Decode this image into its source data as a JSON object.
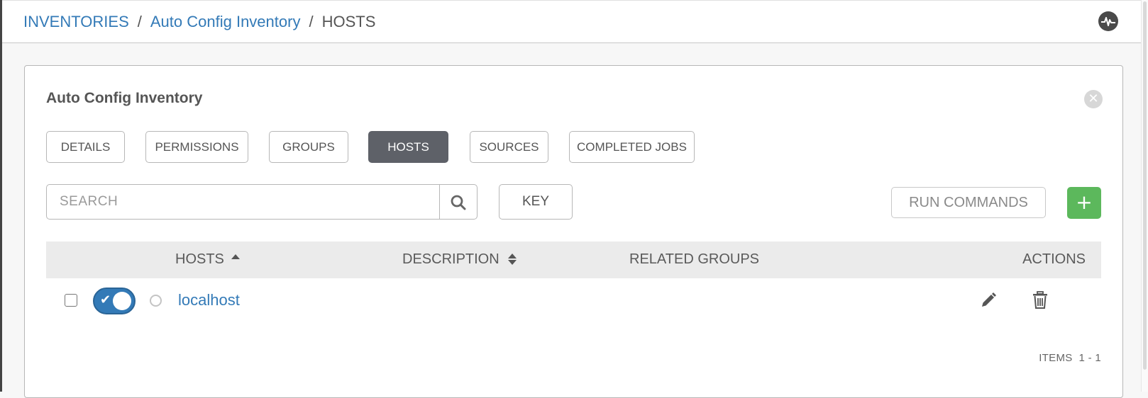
{
  "breadcrumb": {
    "items": [
      "INVENTORIES",
      "Auto Config Inventory",
      "HOSTS"
    ],
    "separator": "/"
  },
  "header": {
    "activity_icon": "activity-stream-icon"
  },
  "panel": {
    "title": "Auto Config Inventory",
    "close_icon": "close-icon",
    "close_glyph": "✕"
  },
  "tabs": [
    {
      "label": "DETAILS",
      "active": false
    },
    {
      "label": "PERMISSIONS",
      "active": false
    },
    {
      "label": "GROUPS",
      "active": false
    },
    {
      "label": "HOSTS",
      "active": true
    },
    {
      "label": "SOURCES",
      "active": false
    },
    {
      "label": "COMPLETED JOBS",
      "active": false
    }
  ],
  "search": {
    "placeholder": "SEARCH",
    "value": ""
  },
  "toolbar": {
    "key_label": "KEY",
    "run_commands_label": "RUN COMMANDS",
    "add_label": "+"
  },
  "table": {
    "columns": {
      "hosts": "HOSTS",
      "description": "DESCRIPTION",
      "related_groups": "RELATED GROUPS",
      "actions": "ACTIONS"
    },
    "rows": [
      {
        "name": "localhost",
        "description": "",
        "related_groups": "",
        "enabled": true,
        "check_glyph": "✔"
      }
    ]
  },
  "pagination": {
    "label": "ITEMS",
    "range": "1 - 1"
  },
  "colors": {
    "link": "#337ab7",
    "active_tab": "#5e6168",
    "add_button": "#5cb85c",
    "toggle_on": "#337ab7"
  }
}
